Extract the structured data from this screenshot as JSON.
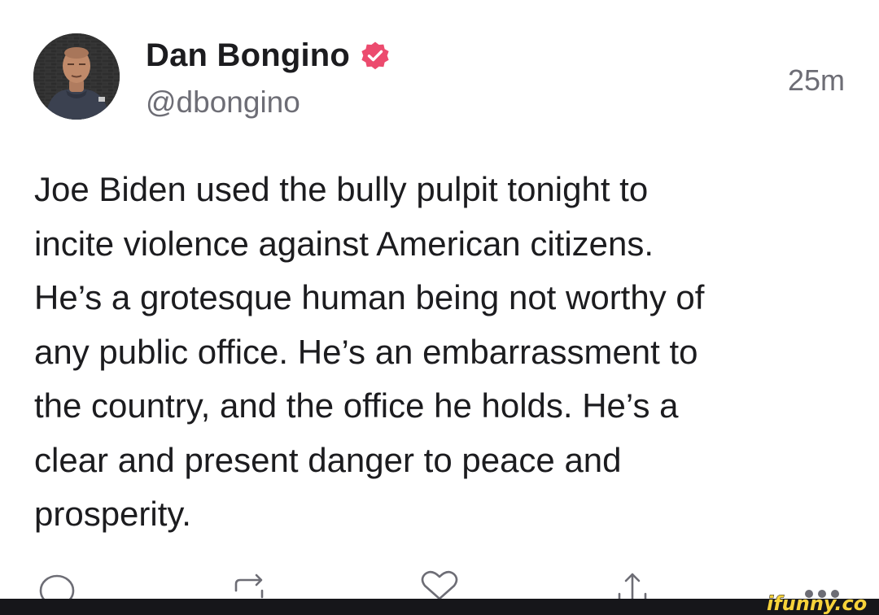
{
  "tweet": {
    "display_name": "Dan Bongino",
    "handle": "@dbongino",
    "timestamp": "25m",
    "text_lines": [
      "Joe Biden used the bully pulpit tonight to",
      "incite violence against American citizens.",
      "He’s a grotesque human being not worthy of",
      "any public office. He’s an embarrassment to",
      "the country, and the office he holds. He’s a",
      "clear and present danger to peace and",
      "prosperity."
    ]
  },
  "icons": {
    "verified": "verified-badge-icon",
    "reply": "reply-icon",
    "repost": "repost-icon",
    "like": "heart-icon",
    "share": "share-icon",
    "more": "more-dots-icon"
  },
  "watermark": {
    "text": "ifunny.co"
  },
  "colors": {
    "text": "#1c1c1f",
    "secondary_text": "#6d6d75",
    "verified_badge": "#ec4b6e",
    "watermark": "#f6d23a",
    "bottom_bar": "#16161a"
  }
}
